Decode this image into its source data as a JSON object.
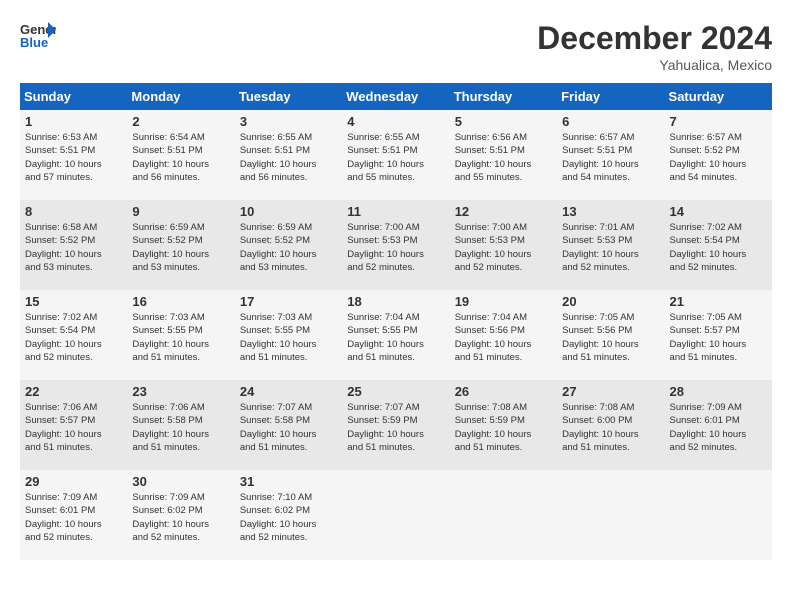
{
  "header": {
    "logo_line1": "General",
    "logo_line2": "Blue",
    "month_title": "December 2024",
    "location": "Yahualica, Mexico"
  },
  "days_of_week": [
    "Sunday",
    "Monday",
    "Tuesday",
    "Wednesday",
    "Thursday",
    "Friday",
    "Saturday"
  ],
  "weeks": [
    [
      {
        "num": "1",
        "info": "Sunrise: 6:53 AM\nSunset: 5:51 PM\nDaylight: 10 hours\nand 57 minutes."
      },
      {
        "num": "2",
        "info": "Sunrise: 6:54 AM\nSunset: 5:51 PM\nDaylight: 10 hours\nand 56 minutes."
      },
      {
        "num": "3",
        "info": "Sunrise: 6:55 AM\nSunset: 5:51 PM\nDaylight: 10 hours\nand 56 minutes."
      },
      {
        "num": "4",
        "info": "Sunrise: 6:55 AM\nSunset: 5:51 PM\nDaylight: 10 hours\nand 55 minutes."
      },
      {
        "num": "5",
        "info": "Sunrise: 6:56 AM\nSunset: 5:51 PM\nDaylight: 10 hours\nand 55 minutes."
      },
      {
        "num": "6",
        "info": "Sunrise: 6:57 AM\nSunset: 5:51 PM\nDaylight: 10 hours\nand 54 minutes."
      },
      {
        "num": "7",
        "info": "Sunrise: 6:57 AM\nSunset: 5:52 PM\nDaylight: 10 hours\nand 54 minutes."
      }
    ],
    [
      {
        "num": "8",
        "info": "Sunrise: 6:58 AM\nSunset: 5:52 PM\nDaylight: 10 hours\nand 53 minutes."
      },
      {
        "num": "9",
        "info": "Sunrise: 6:59 AM\nSunset: 5:52 PM\nDaylight: 10 hours\nand 53 minutes."
      },
      {
        "num": "10",
        "info": "Sunrise: 6:59 AM\nSunset: 5:52 PM\nDaylight: 10 hours\nand 53 minutes."
      },
      {
        "num": "11",
        "info": "Sunrise: 7:00 AM\nSunset: 5:53 PM\nDaylight: 10 hours\nand 52 minutes."
      },
      {
        "num": "12",
        "info": "Sunrise: 7:00 AM\nSunset: 5:53 PM\nDaylight: 10 hours\nand 52 minutes."
      },
      {
        "num": "13",
        "info": "Sunrise: 7:01 AM\nSunset: 5:53 PM\nDaylight: 10 hours\nand 52 minutes."
      },
      {
        "num": "14",
        "info": "Sunrise: 7:02 AM\nSunset: 5:54 PM\nDaylight: 10 hours\nand 52 minutes."
      }
    ],
    [
      {
        "num": "15",
        "info": "Sunrise: 7:02 AM\nSunset: 5:54 PM\nDaylight: 10 hours\nand 52 minutes."
      },
      {
        "num": "16",
        "info": "Sunrise: 7:03 AM\nSunset: 5:55 PM\nDaylight: 10 hours\nand 51 minutes."
      },
      {
        "num": "17",
        "info": "Sunrise: 7:03 AM\nSunset: 5:55 PM\nDaylight: 10 hours\nand 51 minutes."
      },
      {
        "num": "18",
        "info": "Sunrise: 7:04 AM\nSunset: 5:55 PM\nDaylight: 10 hours\nand 51 minutes."
      },
      {
        "num": "19",
        "info": "Sunrise: 7:04 AM\nSunset: 5:56 PM\nDaylight: 10 hours\nand 51 minutes."
      },
      {
        "num": "20",
        "info": "Sunrise: 7:05 AM\nSunset: 5:56 PM\nDaylight: 10 hours\nand 51 minutes."
      },
      {
        "num": "21",
        "info": "Sunrise: 7:05 AM\nSunset: 5:57 PM\nDaylight: 10 hours\nand 51 minutes."
      }
    ],
    [
      {
        "num": "22",
        "info": "Sunrise: 7:06 AM\nSunset: 5:57 PM\nDaylight: 10 hours\nand 51 minutes."
      },
      {
        "num": "23",
        "info": "Sunrise: 7:06 AM\nSunset: 5:58 PM\nDaylight: 10 hours\nand 51 minutes."
      },
      {
        "num": "24",
        "info": "Sunrise: 7:07 AM\nSunset: 5:58 PM\nDaylight: 10 hours\nand 51 minutes."
      },
      {
        "num": "25",
        "info": "Sunrise: 7:07 AM\nSunset: 5:59 PM\nDaylight: 10 hours\nand 51 minutes."
      },
      {
        "num": "26",
        "info": "Sunrise: 7:08 AM\nSunset: 5:59 PM\nDaylight: 10 hours\nand 51 minutes."
      },
      {
        "num": "27",
        "info": "Sunrise: 7:08 AM\nSunset: 6:00 PM\nDaylight: 10 hours\nand 51 minutes."
      },
      {
        "num": "28",
        "info": "Sunrise: 7:09 AM\nSunset: 6:01 PM\nDaylight: 10 hours\nand 52 minutes."
      }
    ],
    [
      {
        "num": "29",
        "info": "Sunrise: 7:09 AM\nSunset: 6:01 PM\nDaylight: 10 hours\nand 52 minutes."
      },
      {
        "num": "30",
        "info": "Sunrise: 7:09 AM\nSunset: 6:02 PM\nDaylight: 10 hours\nand 52 minutes."
      },
      {
        "num": "31",
        "info": "Sunrise: 7:10 AM\nSunset: 6:02 PM\nDaylight: 10 hours\nand 52 minutes."
      },
      {
        "num": "",
        "info": ""
      },
      {
        "num": "",
        "info": ""
      },
      {
        "num": "",
        "info": ""
      },
      {
        "num": "",
        "info": ""
      }
    ]
  ]
}
